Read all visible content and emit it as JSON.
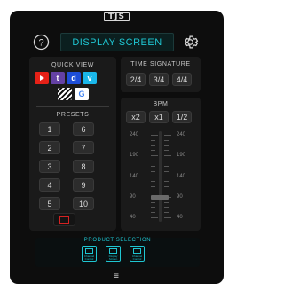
{
  "header": {
    "logo": "TJS",
    "display_label": "DISPLAY SCREEN"
  },
  "quick_view": {
    "title": "QUICK VIEW",
    "apps": [
      {
        "name": "youtube-app-icon",
        "glyph": "▶",
        "color": "#e62117"
      },
      {
        "name": "twitch-app-icon",
        "glyph": "t",
        "color": "#6441a5"
      },
      {
        "name": "dailymotion-app-icon",
        "glyph": "d",
        "color": "#1d4ed8"
      },
      {
        "name": "vimeo-app-icon",
        "glyph": "v",
        "color": "#1ab7ea"
      },
      {
        "name": "stripes-app-icon",
        "glyph": "",
        "color": "#ffffff"
      },
      {
        "name": "google-app-icon",
        "glyph": "G",
        "color": "#ffffff"
      }
    ]
  },
  "presets": {
    "title": "PRESETS",
    "items": [
      "1",
      "6",
      "2",
      "7",
      "3",
      "8",
      "4",
      "9",
      "5",
      "10"
    ]
  },
  "time_signature": {
    "title": "TIME SIGNATURE",
    "options": [
      "2/4",
      "3/4",
      "4/4"
    ]
  },
  "bpm": {
    "title": "BPM",
    "multipliers": [
      "x2",
      "x1",
      "1/2"
    ],
    "scale": [
      "240",
      "190",
      "140",
      "90",
      "40"
    ],
    "value_fraction": 0.25,
    "accent": "#1fc6d2"
  },
  "product_selection": {
    "title": "PRODUCT SELECTION",
    "cards": [
      {
        "caption_line1": "Channel",
        "caption_line2": "Control"
      },
      {
        "caption_line1": "Display",
        "caption_line2": "Screen"
      },
      {
        "caption_line1": "Channel",
        "caption_line2": "Control"
      }
    ]
  },
  "footer": {
    "menu_glyph": "≡"
  }
}
